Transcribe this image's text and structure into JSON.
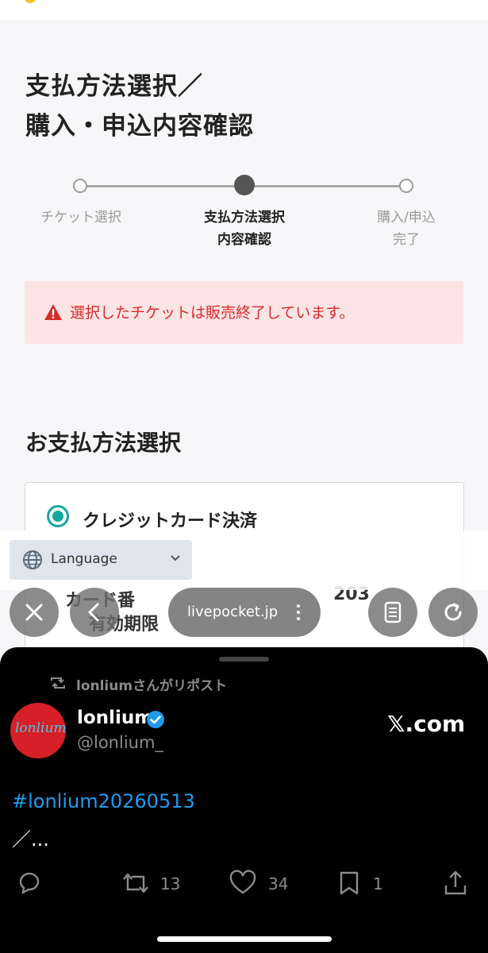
{
  "page": {
    "title_line1": "支払方法選択／",
    "title_line2": "購入・申込内容確認",
    "steps": [
      {
        "label_line1": "チケット選択",
        "label_line2": "",
        "state": "done"
      },
      {
        "label_line1": "支払方法選択",
        "label_line2": "内容確認",
        "state": "active"
      },
      {
        "label_line1": "購入/申込",
        "label_line2": "完了",
        "state": "pending"
      }
    ],
    "alert_message": "選択したチケットは販売終了しています。",
    "payment_section_title": "お支払方法選択",
    "payment_option_label": "クレジットカード決済",
    "card_number_partial": "カード番",
    "card_expiry_partial": "有効期限",
    "card_year_partial": "203"
  },
  "language": {
    "label": "Language"
  },
  "browser": {
    "url": "livepocket.jp"
  },
  "tweet": {
    "repost_text": "lonliumさんがリポスト",
    "display_name": "lonlium",
    "handle": "@lonlium_",
    "avatar_text": "lonlium",
    "source": "𝕏.com",
    "hashtag": "#lonlium20260513",
    "body": "／...",
    "retweets": "13",
    "likes": "34",
    "bookmarks": "1"
  },
  "colors": {
    "accent_teal": "#13a89e",
    "alert_bg": "#fde4e4",
    "alert_text": "#d92b2b",
    "link_blue": "#1d9bf0",
    "avatar_red": "#d61f26"
  }
}
